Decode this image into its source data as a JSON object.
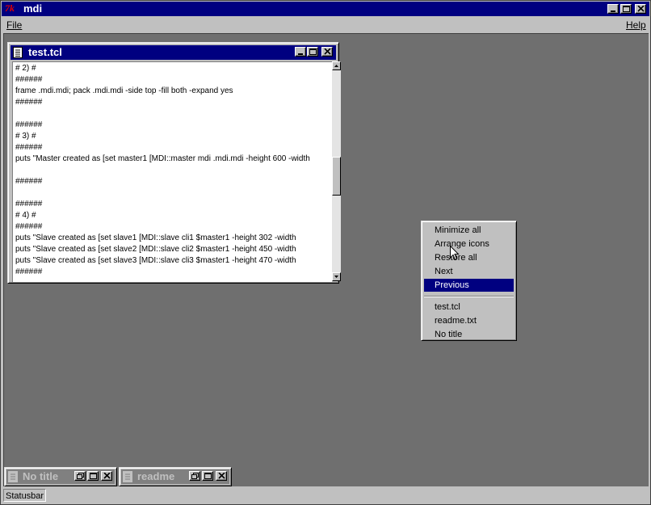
{
  "app": {
    "logo": "7k",
    "title": "mdi"
  },
  "menubar": {
    "file_label": "File",
    "help_label": "Help"
  },
  "caption_buttons": {
    "minimize": "minimize",
    "maximize": "maximize",
    "close": "close",
    "restore": "restore"
  },
  "editor_window": {
    "title": "test.tcl",
    "lines": [
      "# 2) #",
      "######",
      "frame .mdi.mdi;  pack .mdi.mdi  -side top -fill both -expand yes",
      "######",
      "",
      "######",
      "# 3) #",
      "######",
      "puts \"Master created as [set master1 [MDI::master mdi .mdi.mdi -height 600 -width",
      "",
      "######",
      "",
      "######",
      "# 4) #",
      "######",
      "puts \"Slave  created as [set slave1  [MDI::slave cli1 $master1 -height 302 -width",
      "puts \"Slave  created as [set slave2  [MDI::slave cli2 $master1 -height 450 -width",
      "puts \"Slave  created as [set slave3  [MDI::slave cli3 $master1 -height 470 -width",
      "######"
    ]
  },
  "popup_menu": {
    "items": [
      "Minimize all",
      "Arrange icons",
      "Restore all",
      "Next",
      "Previous"
    ],
    "windows": [
      "test.tcl",
      "readme.txt",
      "No title"
    ],
    "selected": "Previous"
  },
  "minimized": [
    {
      "label": "No title"
    },
    {
      "label": "readme"
    }
  ],
  "statusbar": {
    "text": "Statusbar"
  }
}
